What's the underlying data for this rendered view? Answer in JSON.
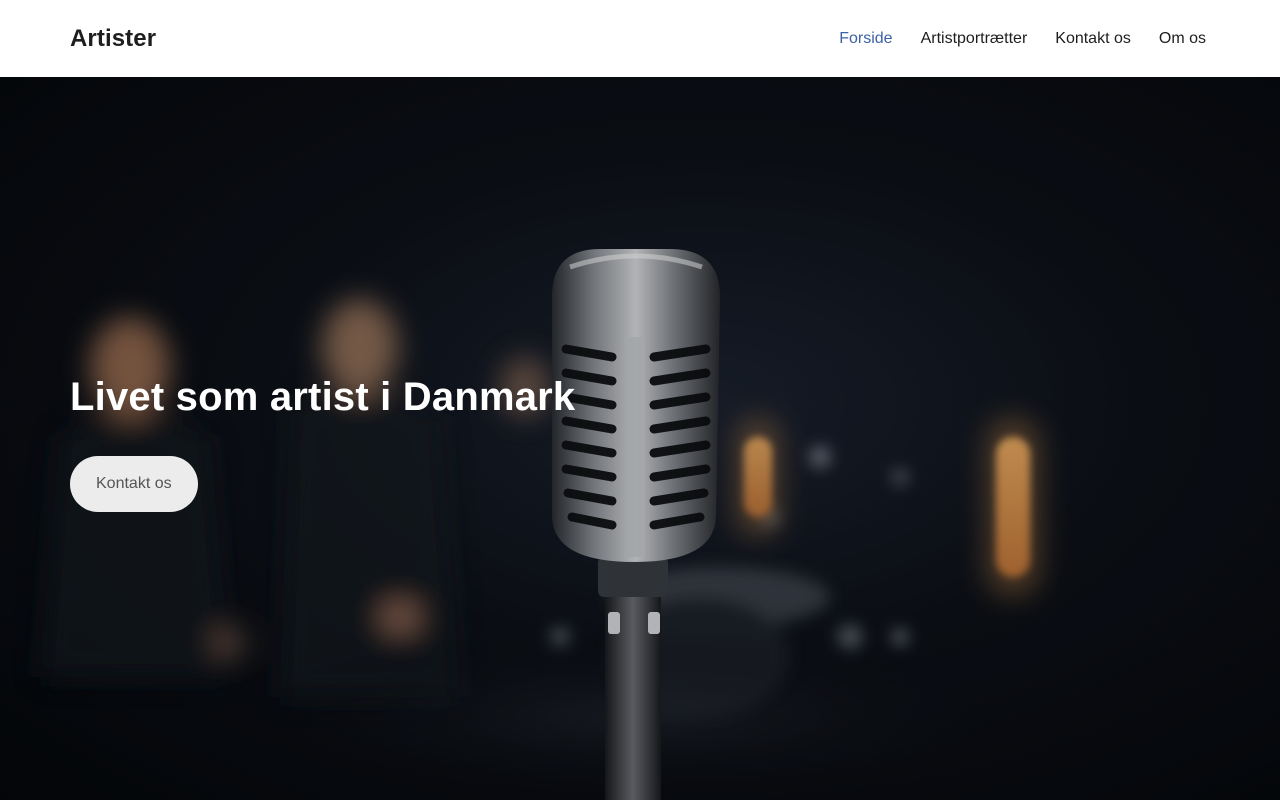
{
  "site": {
    "title": "Artister"
  },
  "nav": {
    "items": [
      {
        "label": "Forside",
        "active": true
      },
      {
        "label": "Artistportrætter",
        "active": false
      },
      {
        "label": "Kontakt os",
        "active": false
      },
      {
        "label": "Om os",
        "active": false
      }
    ]
  },
  "hero": {
    "title": "Livet som artist i Danmark",
    "button_label": "Kontakt os",
    "background_image": "microphone-on-stage-photo"
  },
  "colors": {
    "header_bg": "#ffffff",
    "nav_active": "#3d62a8",
    "text_dark": "#1e1e1e",
    "hero_bg": "#05070b",
    "button_bg": "#ececec",
    "button_text": "#555555"
  }
}
